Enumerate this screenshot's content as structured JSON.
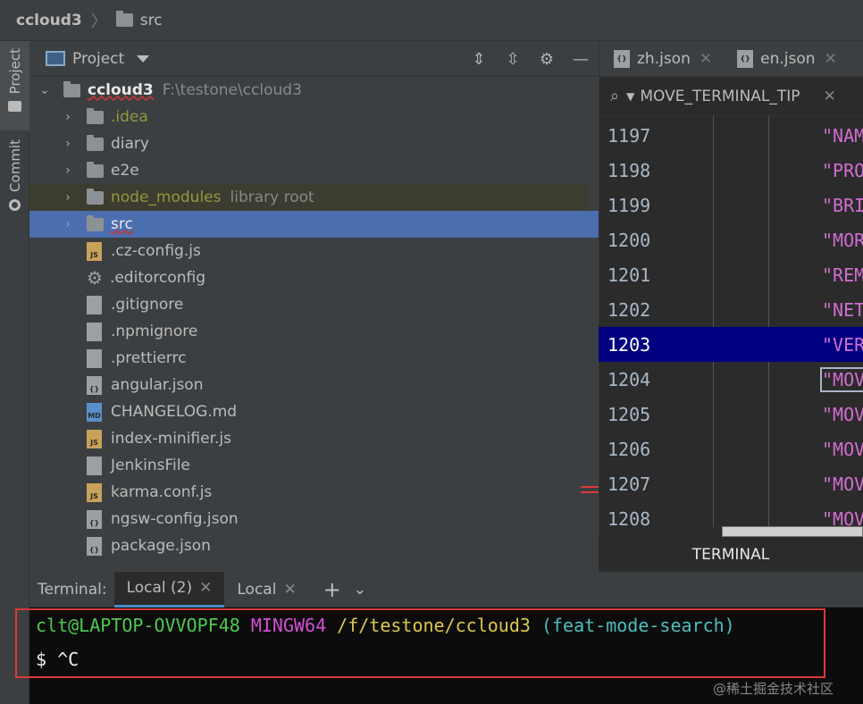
{
  "navbar": {
    "project": "ccloud3",
    "folder": "src"
  },
  "sidebar": {
    "project_tab": "Project",
    "commit_tab": "Commit"
  },
  "project_panel": {
    "title": "Project",
    "root": {
      "name": "ccloud3",
      "path": "F:\\testone\\ccloud3"
    },
    "items": [
      {
        "label": "ccloud3",
        "path": "F:\\testone\\ccloud3",
        "type": "root"
      },
      {
        "label": ".idea",
        "type": "folder"
      },
      {
        "label": "diary",
        "type": "folder"
      },
      {
        "label": "e2e",
        "type": "folder"
      },
      {
        "label": "node_modules",
        "sub": "library root",
        "type": "folder"
      },
      {
        "label": "src",
        "type": "folder"
      },
      {
        "label": ".cz-config.js",
        "type": "js"
      },
      {
        "label": ".editorconfig",
        "type": "gear"
      },
      {
        "label": ".gitignore",
        "type": "file"
      },
      {
        "label": ".npmignore",
        "type": "file"
      },
      {
        "label": ".prettierrc",
        "type": "file"
      },
      {
        "label": "angular.json",
        "type": "json"
      },
      {
        "label": "CHANGELOG.md",
        "type": "md"
      },
      {
        "label": "index-minifier.js",
        "type": "js"
      },
      {
        "label": "JenkinsFile",
        "type": "file"
      },
      {
        "label": "karma.conf.js",
        "type": "js"
      },
      {
        "label": "ngsw-config.json",
        "type": "json"
      },
      {
        "label": "package.json",
        "type": "json"
      }
    ]
  },
  "editor": {
    "tabs": [
      {
        "label": "zh.json"
      },
      {
        "label": "en.json"
      }
    ],
    "search_query": "MOVE_TERMINAL_TIP",
    "lines": [
      {
        "num": "1197",
        "code": "\"NAM"
      },
      {
        "num": "1198",
        "code": "\"PRO"
      },
      {
        "num": "1199",
        "code": "\"BRI"
      },
      {
        "num": "1200",
        "code": "\"MOR"
      },
      {
        "num": "1201",
        "code": "\"REM"
      },
      {
        "num": "1202",
        "code": "\"NET"
      },
      {
        "num": "1203",
        "code": "\"VER"
      },
      {
        "num": "1204",
        "code": "\"MOV"
      },
      {
        "num": "1205",
        "code": "\"MOV"
      },
      {
        "num": "1206",
        "code": "\"MOV"
      },
      {
        "num": "1207",
        "code": "\"MOV"
      },
      {
        "num": "1208",
        "code": "\"MOV"
      }
    ],
    "bottom_label": "TERMINAL"
  },
  "terminal": {
    "label": "Terminal:",
    "tabs": [
      {
        "label": "Local (2)"
      },
      {
        "label": "Local"
      }
    ],
    "prompt": {
      "user": "clt@LAPTOP-OVVOPF48",
      "system": "MINGW64",
      "path": "/f/testone/ccloud3",
      "branch": "(feat-mode-search)"
    },
    "input": "$ ^C"
  },
  "watermark": "@稀土掘金技术社区"
}
